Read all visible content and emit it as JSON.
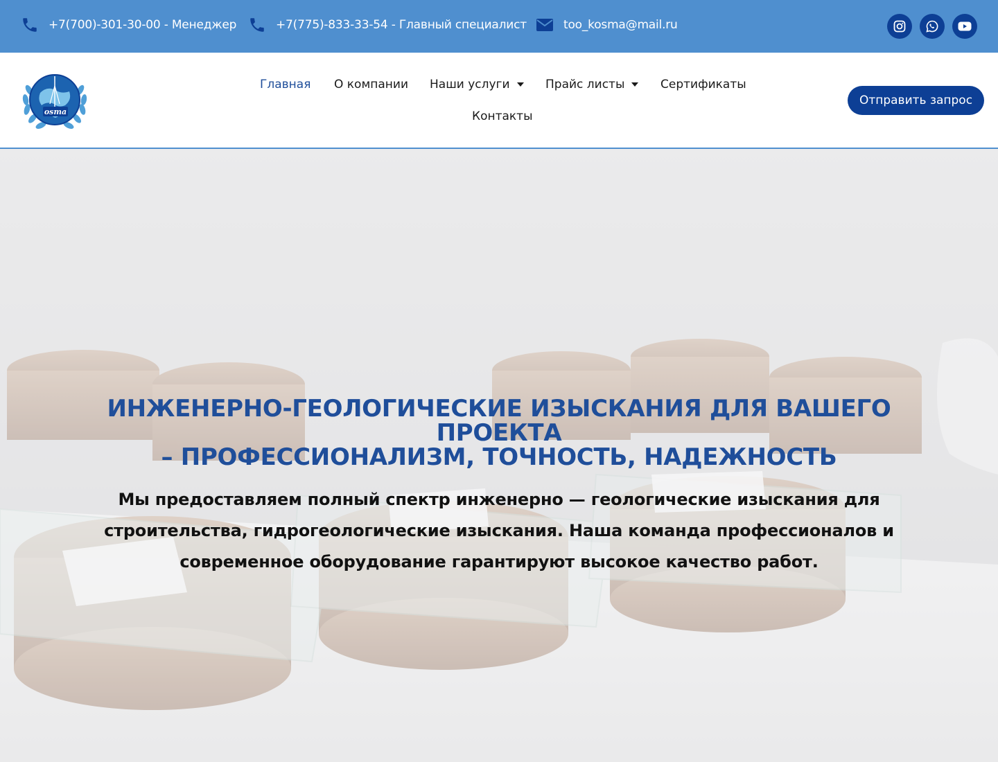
{
  "topbar": {
    "contacts": [
      {
        "icon": "phone-icon",
        "text": "+7(700)-301-30-00 - Менеджер"
      },
      {
        "icon": "phone-icon",
        "text": "+7(775)-833-33-54 - Главный специалист"
      },
      {
        "icon": "envelope-icon",
        "text": "too_kosma@mail.ru"
      }
    ],
    "social": [
      "instagram-icon",
      "whatsapp-icon",
      "youtube-icon"
    ],
    "bg_color": "#4f8fcf",
    "social_bg": "#0d3f95"
  },
  "header": {
    "logo_text": "Kosma",
    "nav": [
      {
        "label": "Главная",
        "active": true
      },
      {
        "label": "О компании"
      },
      {
        "label": "Наши услуги",
        "dropdown": true
      },
      {
        "label": "Прайс листы",
        "dropdown": true
      },
      {
        "label": "Сертификаты"
      },
      {
        "label": "Контакты"
      }
    ],
    "cta_label": "Отправить запрос",
    "accent": "#0d3f95"
  },
  "hero": {
    "title_lines": [
      "ИНЖЕНЕРНО-ГЕОЛОГИЧЕСКИЕ ИЗЫСКАНИЯ ДЛЯ ВАШЕГО",
      "ПРОЕКТА",
      "– ПРОФЕССИОНАЛИЗМ, ТОЧНОСТЬ, НАДЕЖНОСТЬ"
    ],
    "subtitle": "Мы предоставляем полный спектр инженерно — геологические изыскания для строительства, гидрогеологические изыскания. Наша команда профессионалов и современное оборудование гарантируют высокое качество работ.",
    "title_color": "#1f4e9a"
  }
}
